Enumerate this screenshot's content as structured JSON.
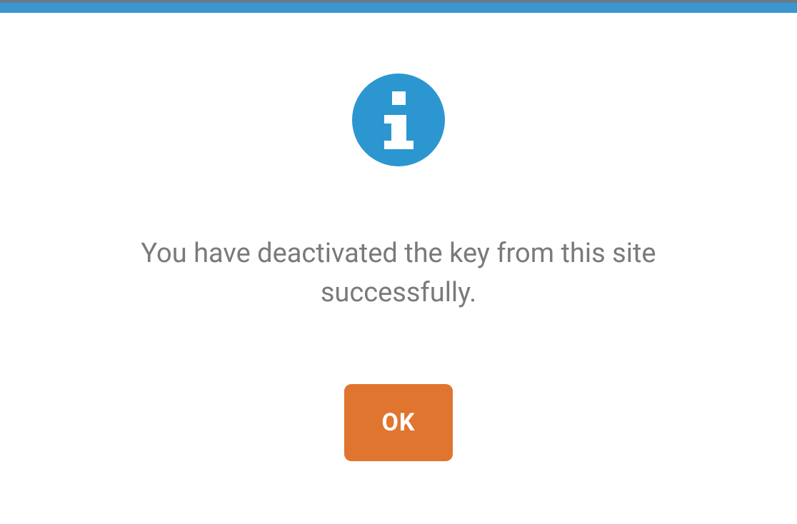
{
  "dialog": {
    "message": "You have deactivated the key from this site successfully.",
    "ok_label": "OK"
  },
  "colors": {
    "accent_blue": "#2c96d1",
    "button_orange": "#e0752f",
    "text_gray": "#7a7a7a"
  }
}
